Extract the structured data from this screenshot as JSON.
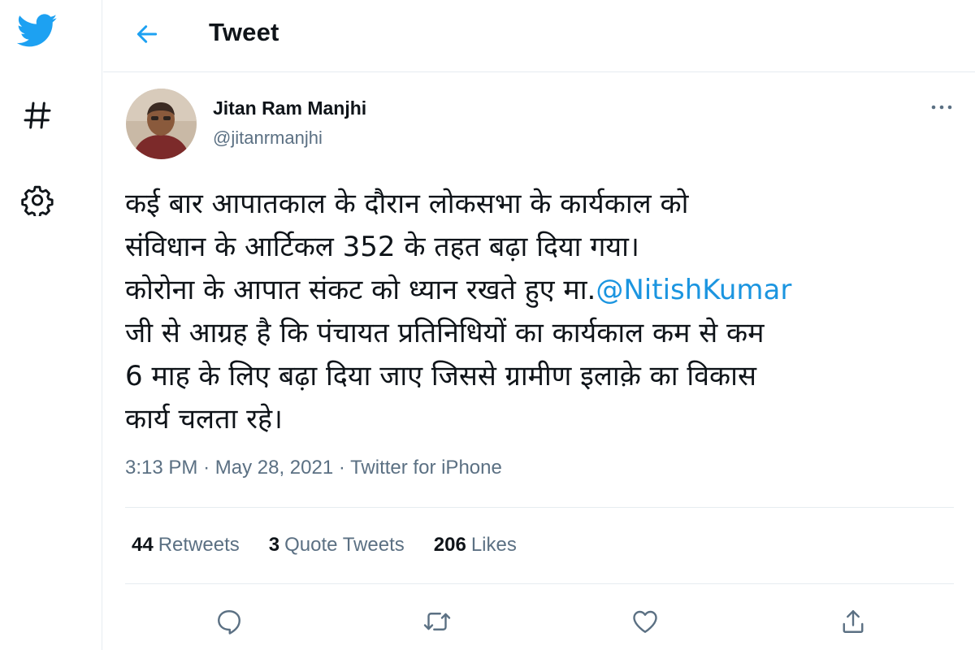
{
  "colors": {
    "brand": "#1da1f2",
    "mention": "#1b95e0",
    "text_primary": "#0f1419",
    "text_secondary": "#5b7083",
    "divider": "#e6ecf0"
  },
  "nav": {
    "logo_icon": "twitter-bird-icon",
    "explore_icon": "hashtag-icon",
    "settings_icon": "gear-icon"
  },
  "header": {
    "back_icon": "arrow-left-icon",
    "title": "Tweet"
  },
  "tweet": {
    "author": {
      "name": "Jitan Ram Manjhi",
      "handle": "@jitanrmanjhi",
      "avatar_icon": "user-avatar"
    },
    "more_icon": "more-horizontal-icon",
    "text_lines": [
      "कई बार आपातकाल के दौरान लोकसभा के कार्यकाल को",
      "संविधान के आर्टिकल 352 के तहत बढ़ा दिया गया।",
      "कोरोना के आपात संकट को ध्यान रखते हुए मा.",
      "जी से आग्रह है कि पंचायत प्रतिनिधियों का कार्यकाल कम से कम",
      "6 माह के लिए बढ़ा दिया जाए जिससे ग्रामीण इलाक़े का विकास",
      "कार्य चलता रहे।"
    ],
    "mention": "@NitishKumar",
    "time": "3:13 PM",
    "separator": "·",
    "date": "May 28, 2021",
    "source": "Twitter for iPhone",
    "stats": {
      "retweets_count": "44",
      "retweets_label": "Retweets",
      "quotes_count": "3",
      "quotes_label": "Quote Tweets",
      "likes_count": "206",
      "likes_label": "Likes"
    },
    "actions": {
      "reply_icon": "reply-icon",
      "retweet_icon": "retweet-icon",
      "like_icon": "heart-icon",
      "share_icon": "share-icon"
    }
  }
}
